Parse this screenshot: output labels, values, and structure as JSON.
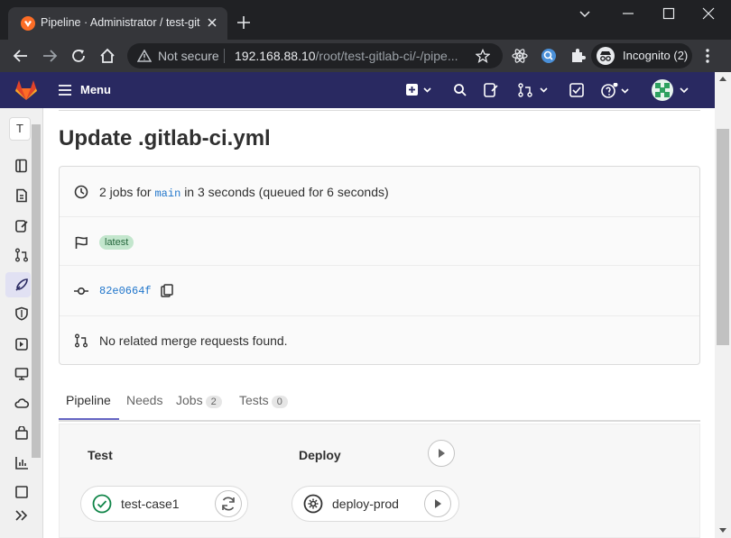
{
  "browser": {
    "tab_title": "Pipeline · Administrator / test-git",
    "security_label": "Not secure",
    "url_host": "192.168.88.10",
    "url_path": "/root/test-gitlab-ci/-/pipe...",
    "incognito_label": "Incognito (2)"
  },
  "gitlab_nav": {
    "menu_label": "Menu"
  },
  "sidebar": {
    "top_letter": "T"
  },
  "pipeline": {
    "title": "Update .gitlab-ci.yml",
    "jobs_summary_prefix": "2 jobs for",
    "branch": "main",
    "jobs_summary_suffix": "in 3 seconds (queued for 6 seconds)",
    "badge": "latest",
    "commit_sha": "82e0664f",
    "merge_requests": "No related merge requests found."
  },
  "tabs": [
    {
      "label": "Pipeline"
    },
    {
      "label": "Needs"
    },
    {
      "label": "Jobs",
      "count": "2"
    },
    {
      "label": "Tests",
      "count": "0"
    }
  ],
  "graph": {
    "stages": [
      {
        "name": "Test",
        "job": "test-case1",
        "status": "passed"
      },
      {
        "name": "Deploy",
        "job": "deploy-prod",
        "status": "manual"
      }
    ]
  },
  "colors": {
    "gitlab_nav": "#292961",
    "success": "#108548",
    "link": "#1f75cb",
    "tab_active": "#6666c4"
  }
}
